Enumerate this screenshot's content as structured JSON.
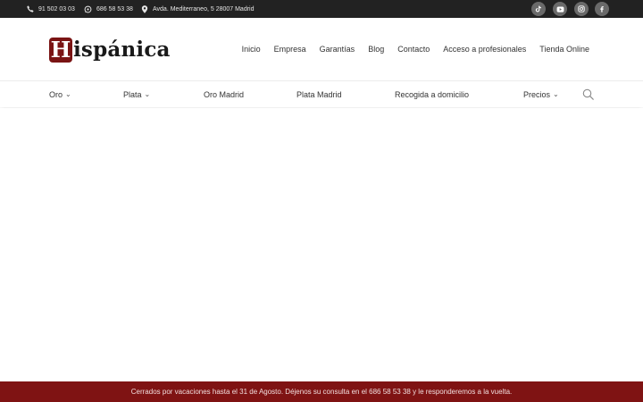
{
  "topbar": {
    "phone": "91 502 03 03",
    "whatsapp": "686 58 53 38",
    "address": "Avda. Mediterraneo, 5 28007 Madrid",
    "social": [
      "tiktok-icon",
      "youtube-icon",
      "instagram-icon",
      "facebook-icon"
    ]
  },
  "brand": {
    "logo_initial": "H",
    "logo_rest": "ispánica",
    "color": "#7a1414"
  },
  "nav": {
    "items": [
      "Inicio",
      "Empresa",
      "Garantías",
      "Blog",
      "Contacto",
      "Acceso a profesionales",
      "Tienda Online"
    ]
  },
  "categories": {
    "items": [
      {
        "label": "Oro",
        "dropdown": true
      },
      {
        "label": "Plata",
        "dropdown": true
      },
      {
        "label": "Oro Madrid",
        "dropdown": false
      },
      {
        "label": "Plata Madrid",
        "dropdown": false
      },
      {
        "label": "Recogida a domicilio",
        "dropdown": false
      },
      {
        "label": "Precios",
        "dropdown": true
      }
    ],
    "search_icon": "search-icon"
  },
  "notice": {
    "text": "Cerrados por vacaciones hasta el 31 de Agosto. Déjenos su consulta en el 686 58 53 38 y le responderemos a la vuelta.",
    "background": "#7f1313"
  }
}
